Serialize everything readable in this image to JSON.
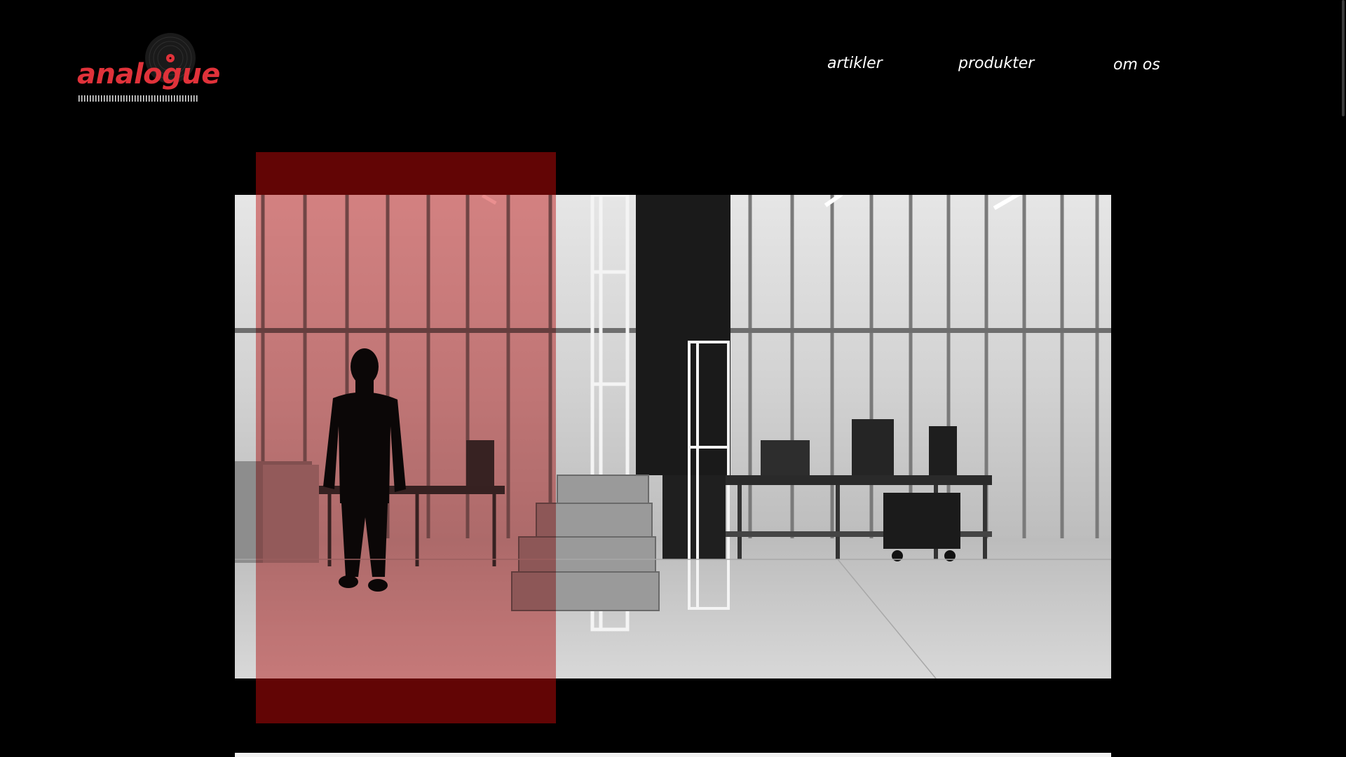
{
  "brand": {
    "logo_text": "analogue",
    "logo_small_text": "analogue"
  },
  "nav": {
    "items": [
      {
        "label": "artikler"
      },
      {
        "label": "produkter"
      },
      {
        "label": "om os"
      }
    ]
  },
  "hero": {
    "accent_color": "#620505",
    "tint_color": "#d62828",
    "image_subject": "person-in-warehouse-photo"
  },
  "colors": {
    "background": "#000000",
    "brand_red": "#e0323a",
    "nav_text": "#ffffff"
  }
}
